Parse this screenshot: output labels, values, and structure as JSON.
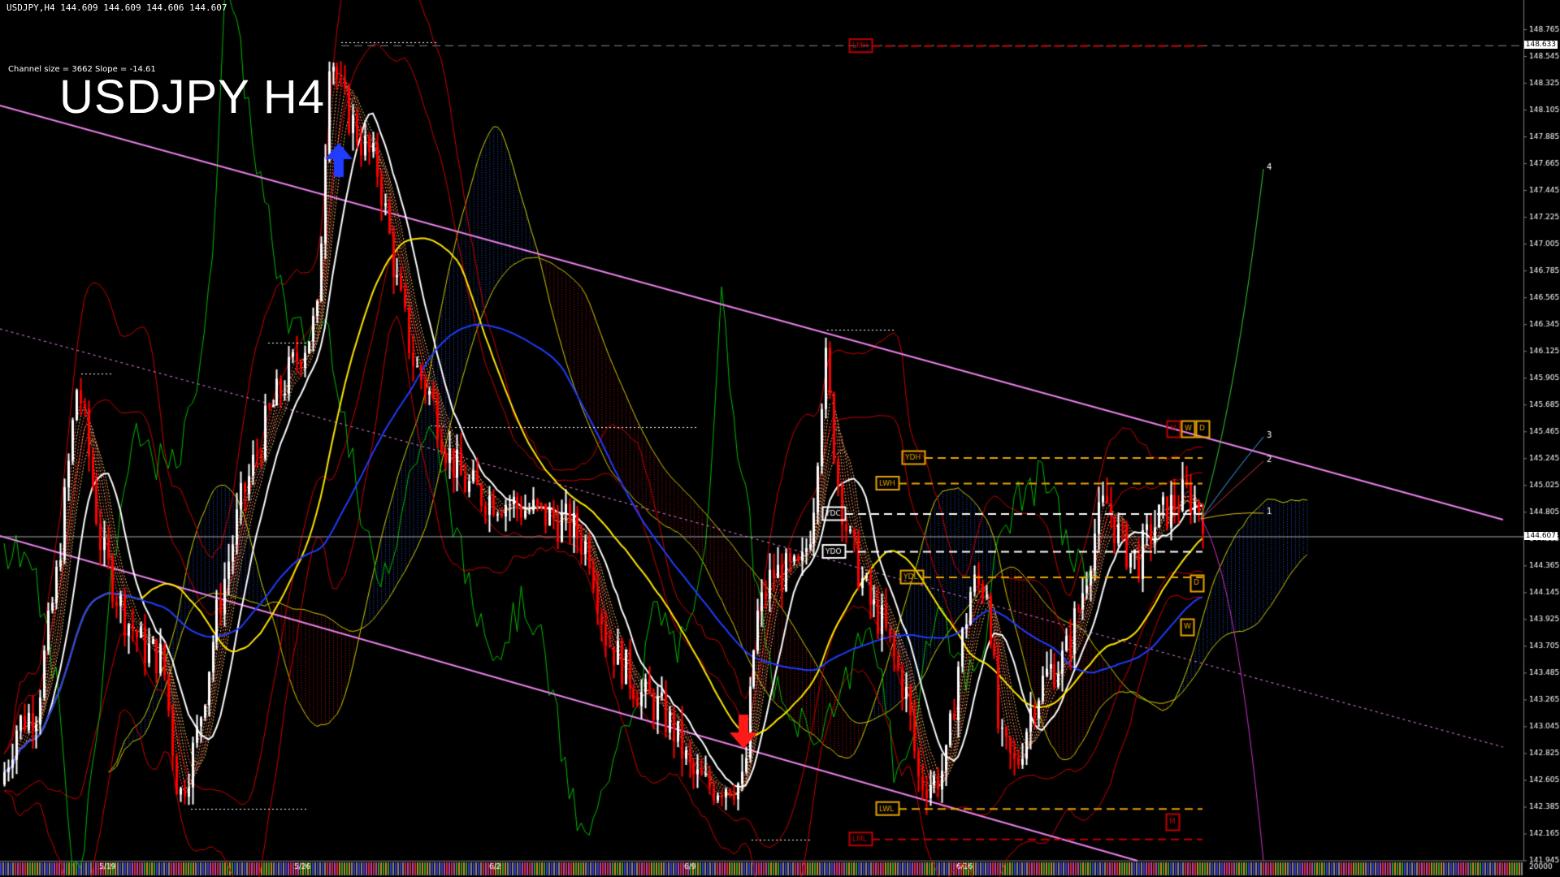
{
  "header": {
    "symbol_line": "USDJPY,H4  144.609 144.609 144.606 144.607",
    "channel_info": "Channel size = 3662  Slope = -14.61",
    "big_title": "USDJPY H4"
  },
  "colors": {
    "background": "#000000",
    "bull": "#ffffff",
    "bear": "#ff0000",
    "channel": "#ee82ee",
    "sma_blue": "#1e3cff",
    "sma_yellow": "#ffe600",
    "sma_white": "#ffffff",
    "bands": "#cc0000",
    "chikou": "#00bb00",
    "cloud_blue": "#2a5bd7",
    "cloud_red": "#c01818",
    "level_orange": "#e8a400",
    "level_red": "#c00000"
  },
  "chart_data": {
    "type": "candlestick",
    "y_axis": {
      "min": 141.945,
      "max": 148.875,
      "ticks": [
        "148.765",
        "148.545",
        "148.325",
        "148.105",
        "147.885",
        "147.665",
        "147.445",
        "147.225",
        "147.005",
        "146.785",
        "146.565",
        "146.345",
        "146.125",
        "145.905",
        "145.685",
        "145.465",
        "145.245",
        "145.025",
        "144.805",
        "144.585",
        "144.365",
        "144.145",
        "143.925",
        "143.705",
        "143.485",
        "143.265",
        "143.045",
        "142.825",
        "142.605",
        "142.385",
        "142.165",
        "141.945"
      ],
      "volume_label": "20000"
    },
    "x_axis": {
      "date_labels": [
        "5/19",
        "5/26",
        "6/2",
        "6/9",
        "6/16"
      ]
    },
    "price_markers": {
      "current": "144.607",
      "top": "148.633"
    },
    "levels": [
      {
        "label": "LMH",
        "value": 148.63
      },
      {
        "label": "YDH",
        "value": 145.25
      },
      {
        "label": "LWH",
        "value": 145.04
      },
      {
        "label": "YDC",
        "value": 144.79
      },
      {
        "label": "YDO",
        "value": 144.48
      },
      {
        "label": "YDL",
        "value": 144.27
      },
      {
        "label": "LWL",
        "value": 142.37
      },
      {
        "label": "LML",
        "value": 142.12
      }
    ],
    "right_tags": [
      "M",
      "W",
      "D",
      "D",
      "W",
      "M"
    ],
    "projection_labels": [
      "4",
      "3",
      "2",
      "1"
    ]
  }
}
